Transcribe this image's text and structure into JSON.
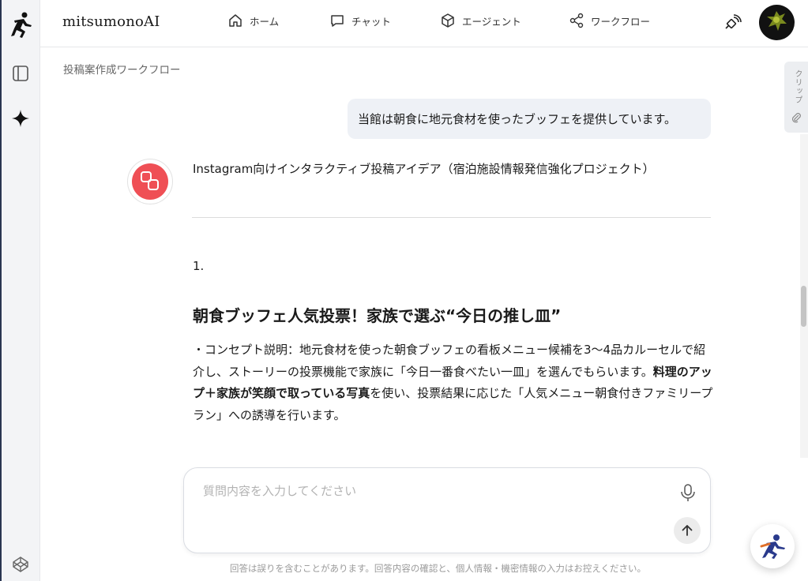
{
  "app": {
    "brand": "mitsumonoAI"
  },
  "rail": {
    "icons": [
      "runner-logo-icon",
      "sidebar-panel-icon",
      "sparkle-icon",
      "codepen-cube-icon"
    ]
  },
  "nav": [
    {
      "label": "ホーム",
      "icon": "home-icon"
    },
    {
      "label": "チャット",
      "icon": "chat-bubble-icon"
    },
    {
      "label": "エージェント",
      "icon": "cube-icon"
    },
    {
      "label": "ワークフロー",
      "icon": "share-nodes-icon"
    }
  ],
  "breadcrumb": "投稿案作成ワークフロー",
  "chat": {
    "user_message": "当館は朝食に地元食材を使ったブッフェを提供しています。",
    "bot_title": "Instagram向けインタラクティブ投稿アイデア（宿泊施設情報発信強化プロジェクト）",
    "item_number": "1.",
    "heading": "朝食ブッフェ人気投票！家族で選ぶ“今日の推し皿”",
    "para_part1": "・コンセプト説明：地元食材を使った朝食ブッフェの看板メニュー候補を3〜4品カルーセルで紹介し、ストーリーの投票機能で家族に「今日一番食べたい一皿」を選んでもらいます。",
    "para_bold": "料理のアップ＋家族が笑顔で取っている写真",
    "para_part2": "を使い、投票結果に応じた「人気メニュー朝食付きファミリープラン」への誘導を行います。"
  },
  "clip_tab": {
    "label": "クリップ"
  },
  "composer": {
    "placeholder": "質問内容を入力してください",
    "disclaimer": "回答は誤りを含むことがあります。回答内容の確認と、個人情報・機密情報の入力はお控えください。"
  },
  "colors": {
    "accent": "#ef4f55",
    "bubble": "#eef1f6",
    "rail": "#f3f4f6"
  }
}
